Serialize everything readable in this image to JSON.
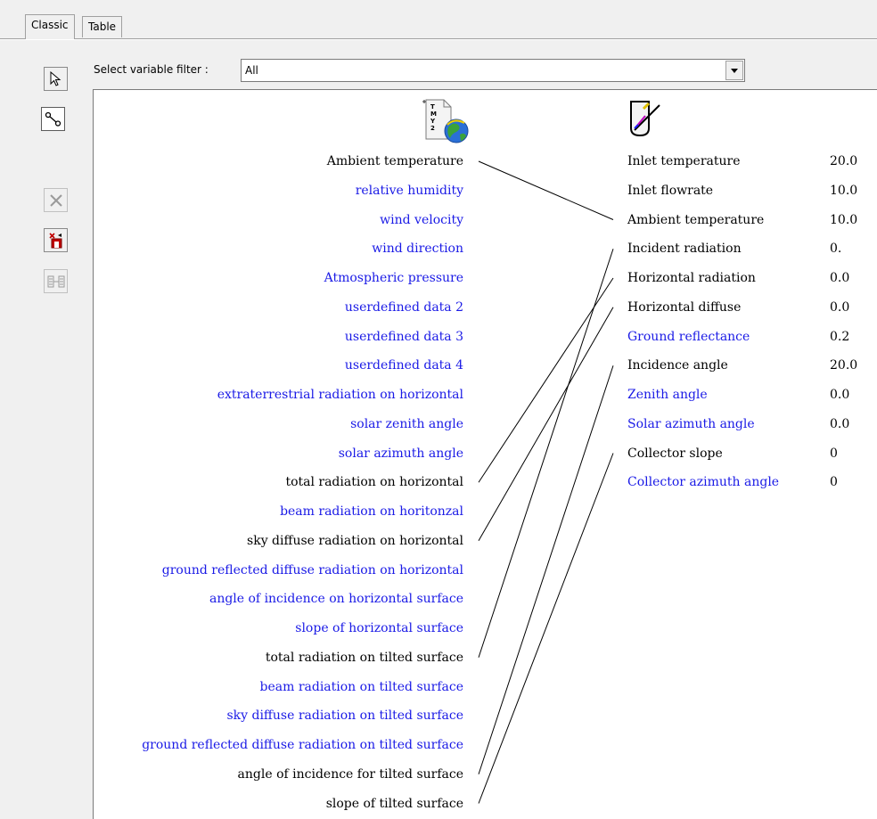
{
  "tabs": [
    {
      "label": "Classic",
      "active": true
    },
    {
      "label": "Table",
      "active": false
    }
  ],
  "toolbar": [
    {
      "icon": "pointer-arrow-icon",
      "state": "normal"
    },
    {
      "icon": "link-connector-icon",
      "state": "pressed"
    },
    {
      "icon": "delete-x-icon",
      "state": "disabled"
    },
    {
      "icon": "delete-connection-icon",
      "state": "normal"
    },
    {
      "icon": "auto-connect-icon",
      "state": "disabled"
    }
  ],
  "filter": {
    "label": "Select variable filter :",
    "value": "All"
  },
  "source_component": {
    "icon": "tmy2-weather-globe-icon"
  },
  "target_component": {
    "icon": "solar-collector-icon"
  },
  "outputs": [
    {
      "label": "Ambient temperature",
      "color": "black"
    },
    {
      "label": "relative humidity",
      "color": "blue"
    },
    {
      "label": "wind velocity",
      "color": "blue"
    },
    {
      "label": "wind direction",
      "color": "blue"
    },
    {
      "label": "Atmospheric pressure",
      "color": "blue"
    },
    {
      "label": "userdefined data 2",
      "color": "blue"
    },
    {
      "label": "userdefined data 3",
      "color": "blue"
    },
    {
      "label": "userdefined data 4",
      "color": "blue"
    },
    {
      "label": "extraterrestrial radiation on horizontal",
      "color": "blue"
    },
    {
      "label": "solar zenith angle",
      "color": "blue"
    },
    {
      "label": "solar azimuth angle",
      "color": "blue"
    },
    {
      "label": "total radiation on horizontal",
      "color": "black"
    },
    {
      "label": "beam radiation on horitonzal",
      "color": "blue"
    },
    {
      "label": "sky diffuse radiation on horizontal",
      "color": "black"
    },
    {
      "label": "ground reflected diffuse radiation on horizontal",
      "color": "blue"
    },
    {
      "label": "angle of incidence on horizontal surface",
      "color": "blue"
    },
    {
      "label": "slope of horizontal surface",
      "color": "blue"
    },
    {
      "label": "total radiation on tilted surface",
      "color": "black"
    },
    {
      "label": "beam radiation on tilted surface",
      "color": "blue"
    },
    {
      "label": "sky diffuse radiation on tilted surface",
      "color": "blue"
    },
    {
      "label": "ground reflected diffuse radiation on tilted surface",
      "color": "blue"
    },
    {
      "label": "angle of incidence for tilted surface",
      "color": "black"
    },
    {
      "label": "slope of tilted surface",
      "color": "black"
    }
  ],
  "inputs": [
    {
      "label": "Inlet temperature",
      "value": "20.0",
      "color": "black"
    },
    {
      "label": "Inlet flowrate",
      "value": "10.0",
      "color": "black"
    },
    {
      "label": "Ambient temperature",
      "value": "10.0",
      "color": "black"
    },
    {
      "label": "Incident radiation",
      "value": "0.",
      "color": "black"
    },
    {
      "label": "Horizontal radiation",
      "value": "0.0",
      "color": "black"
    },
    {
      "label": "Horizontal diffuse",
      "value": "0.0",
      "color": "black"
    },
    {
      "label": "Ground reflectance",
      "value": "0.2",
      "color": "blue"
    },
    {
      "label": "Incidence angle",
      "value": "20.0",
      "color": "black"
    },
    {
      "label": "Zenith angle",
      "value": "0.0",
      "color": "blue"
    },
    {
      "label": "Solar azimuth angle",
      "value": "0.0",
      "color": "blue"
    },
    {
      "label": "Collector slope",
      "value": "0",
      "color": "black"
    },
    {
      "label": "Collector azimuth angle",
      "value": "0",
      "color": "blue"
    }
  ],
  "connections": [
    {
      "from": "Ambient temperature",
      "to": "Ambient temperature"
    },
    {
      "from": "total radiation on horizontal",
      "to": "Horizontal radiation"
    },
    {
      "from": "sky diffuse radiation on horizontal",
      "to": "Horizontal diffuse"
    },
    {
      "from": "total radiation on tilted surface",
      "to": "Incident radiation"
    },
    {
      "from": "angle of incidence for tilted surface",
      "to": "Incidence angle"
    },
    {
      "from": "slope of tilted surface",
      "to": "Collector slope"
    }
  ],
  "colors": {
    "connected": "#000000",
    "unconnected": "#1a1ae6",
    "window_bg": "#f0f0f0",
    "canvas_bg": "#ffffff"
  }
}
